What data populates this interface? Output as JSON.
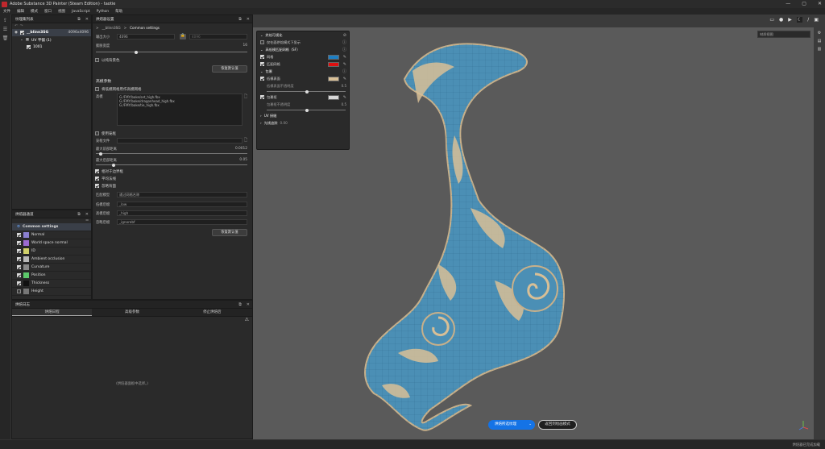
{
  "window": {
    "title": "Adobe Substance 3D Painter (Steam Edition) - taotie",
    "controls": [
      "—",
      "▢",
      "✕"
    ]
  },
  "menu": [
    "文件",
    "编辑",
    "模式",
    "窗口",
    "视图",
    "JavaScript",
    "Python",
    "帮助"
  ],
  "texset": {
    "title": "纹理集列表",
    "set_name": "__blinn3SG",
    "set_res": "4096x4096",
    "uv_label": "UV 平铺 (1)",
    "tile": "1001"
  },
  "bake": {
    "title": "烘焙器设置",
    "breadcrumb_a": "__blinn3SG",
    "breadcrumb_b": "Common settings",
    "output_size_label": "输出大小",
    "output_size": "4096",
    "output_size2": "4096",
    "dilation_label": "膨胀宽度",
    "dilation": "16",
    "dilate_bg": "以纯背景色",
    "reset": "恢复默认值",
    "highpoly_header": "高模参数",
    "use_lowpoly": "将低模网格用作高模网格",
    "mesh_label": "高模",
    "mesh_files": [
      "G:/FMY/bake/set_high.fbx",
      "G:/FMY/bake/dragonhead_high.fbx",
      "G:/FMY/bake/tie_high.fbx"
    ],
    "use_cage": "使用笼框",
    "cage_label": "笼框文件",
    "max_front_label": "最大前部距离",
    "max_front": "0.0012",
    "max_rear_label": "最大后部距离",
    "max_rear": "0.05",
    "relative_bbox": "相对于边界框",
    "average_normals": "平均法线",
    "ignore_backface": "忽略背面",
    "match_label": "匹配模型",
    "match_value": "通过网格名称",
    "lowpoly_suffix_label": "低模后缀",
    "lowpoly_suffix": "_low",
    "highpoly_suffix_label": "高模后缀",
    "highpoly_suffix": "_high",
    "ignore_suffix_label": "忽略后缀",
    "ignore_suffix": "_ignorebf",
    "reset2": "恢复默认值"
  },
  "channels": {
    "title": "烘焙器通道",
    "items": [
      {
        "label": "Common settings",
        "color": "#6aa9ff",
        "on": null
      },
      {
        "label": "Normal",
        "color": "#8a7fd0",
        "on": true
      },
      {
        "label": "World space normal",
        "color": "#9b6ad0",
        "on": true
      },
      {
        "label": "ID",
        "color": "#d0d06a",
        "on": true
      },
      {
        "label": "Ambient occlusion",
        "color": "#b8b8b8",
        "on": true
      },
      {
        "label": "Curvature",
        "color": "#888",
        "on": true
      },
      {
        "label": "Position",
        "color": "#5cc86a",
        "on": true
      },
      {
        "label": "Thickness",
        "color": "#111",
        "on": true
      },
      {
        "label": "Height",
        "color": "#777",
        "on": false
      }
    ]
  },
  "log": {
    "title": "烘焙日志",
    "tabs": [
      "烘焙日程",
      "高级参数",
      "停止烘焙后"
    ],
    "empty": "(烘焙器面板中选择。)"
  },
  "overlay": {
    "title": "烘焙可视化",
    "opt1": "仅在面烘焙模式下显示",
    "sec1": "高低模匹配网格（SF）",
    "c1": "网格",
    "c1color": "#1d7fc4",
    "c2": "匹配网格",
    "c2color": "#e01010",
    "sec2": "包裹",
    "c3": "低模表面",
    "c3color": "#d8bf96",
    "c3s": "低模表面不透明度",
    "c3v": "0.5",
    "c4": "包裹框",
    "c4color": "#d8d8d8",
    "c4s": "包裹框不透明度",
    "c4v": "0.5",
    "sec3": "UV 接缝",
    "sec4": "光线追踪",
    "sec4v": "0.00"
  },
  "viewport": {
    "shading": "材质视图"
  },
  "bake_btn": "烘焙所选纹理",
  "return_btn": "返回到绘画模式",
  "status": {
    "text": "烘焙器已完成加载"
  }
}
